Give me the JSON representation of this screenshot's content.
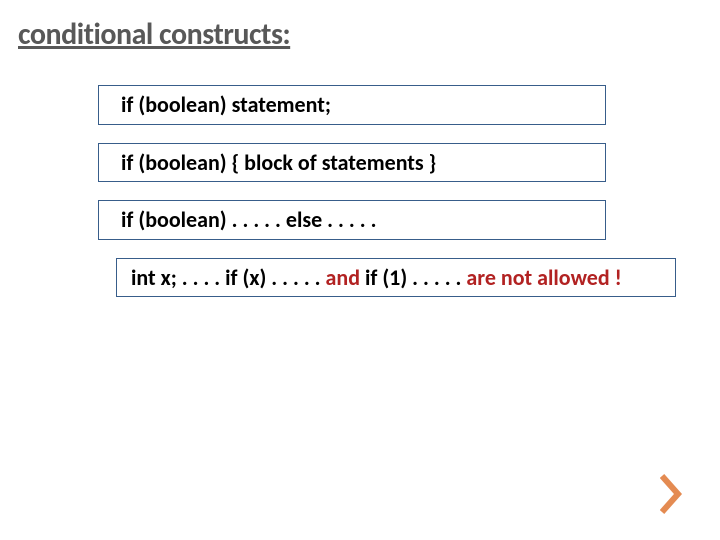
{
  "title": "conditional constructs:",
  "boxes": {
    "b1": "if (boolean) statement;",
    "b2": "if (boolean)  { block of statements }",
    "b3": "if (boolean)  . . . . .   else   . . . . ."
  },
  "note": {
    "seg1": "int x;  . . . .   if (x)   . . . . .",
    "seg_and": " and    ",
    "seg2": "if (1)   . . . . .",
    "tail": "    are not allowed !"
  }
}
